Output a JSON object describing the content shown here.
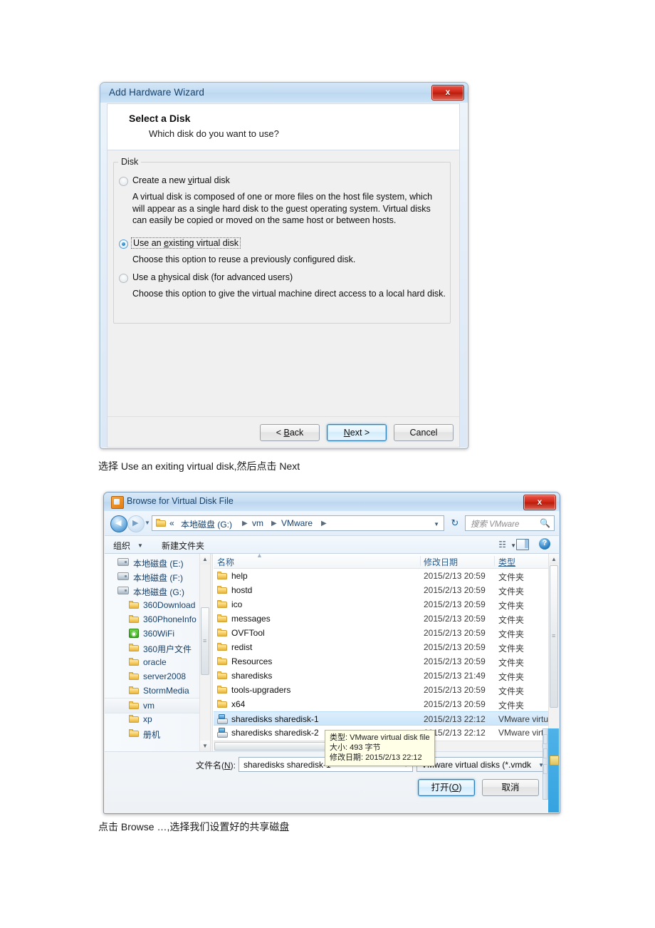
{
  "wizard": {
    "title": "Add Hardware Wizard",
    "close_label": "x",
    "header_title": "Select a Disk",
    "header_subtitle": "Which disk do you want to use?",
    "group_label": "Disk",
    "options": [
      {
        "label_pre": "Create a new ",
        "label_accel": "v",
        "label_post": "irtual disk",
        "selected": false,
        "description": "A virtual disk is composed of one or more files on the host file system, which will appear as a single hard disk to the guest operating system. Virtual disks can easily be copied or moved on the same host or between hosts."
      },
      {
        "label_pre": "Use an ",
        "label_accel": "e",
        "label_post": "xisting virtual disk",
        "selected": true,
        "focused": true,
        "description": "Choose this option to reuse a previously configured disk."
      },
      {
        "label_pre": "Use a ",
        "label_accel": "p",
        "label_post": "hysical disk (for advanced users)",
        "selected": false,
        "description": "Choose this option to give the virtual machine direct access to a local hard disk."
      }
    ],
    "buttons": {
      "back_pre": "< ",
      "back_accel": "B",
      "back_post": "ack",
      "next_pre": "",
      "next_accel": "N",
      "next_post": "ext >",
      "cancel": "Cancel"
    }
  },
  "caption1": "选择 Use an exiting virtual disk,然后点击 Next",
  "caption2": "点击 Browse …,选择我们设置好的共享磁盘",
  "browse": {
    "title": "Browse for Virtual Disk File",
    "close_label": "x",
    "address": {
      "back_glyph": "◀",
      "forward_glyph": "▶",
      "recent_glyph": "▼",
      "chevrons": "«",
      "crumbs": [
        "本地磁盘 (G:)",
        "vm",
        "VMware"
      ],
      "crumb_separator": "▶",
      "dropdown_glyph": "▼",
      "refresh_glyph": "↻"
    },
    "search": {
      "placeholder": "搜索 VMware",
      "icon": "search-icon",
      "icon_glyph": "🔍"
    },
    "commandbar": {
      "organize": "组织",
      "organize_caret": "▼",
      "new_folder": "新建文件夹",
      "view_glyph": "☷",
      "view_caret": "▼",
      "preview_pane": "preview-pane-icon",
      "help_glyph": "?"
    },
    "navpane": {
      "items": [
        {
          "label": "本地磁盘 (E:)",
          "icon": "drive-icon",
          "indent": 18,
          "selected": false
        },
        {
          "label": "本地磁盘 (F:)",
          "icon": "drive-icon",
          "indent": 18,
          "selected": false
        },
        {
          "label": "本地磁盘 (G:)",
          "icon": "drive-icon",
          "indent": 18,
          "selected": false
        },
        {
          "label": "360Download",
          "icon": "folder-icon",
          "indent": 34,
          "selected": false
        },
        {
          "label": "360PhoneInfo",
          "icon": "folder-icon",
          "indent": 34,
          "selected": false
        },
        {
          "label": "360WiFi",
          "icon": "wifi-icon",
          "indent": 34,
          "selected": false
        },
        {
          "label": "360用户文件",
          "icon": "folder-icon",
          "indent": 34,
          "selected": false
        },
        {
          "label": "oracle",
          "icon": "folder-icon",
          "indent": 34,
          "selected": false
        },
        {
          "label": "server2008",
          "icon": "folder-icon",
          "indent": 34,
          "selected": false
        },
        {
          "label": "StormMedia",
          "icon": "folder-icon",
          "indent": 34,
          "selected": false
        },
        {
          "label": "vm",
          "icon": "folder-icon",
          "indent": 34,
          "selected": true
        },
        {
          "label": "xp",
          "icon": "folder-icon",
          "indent": 34,
          "selected": false
        },
        {
          "label": "册机",
          "icon": "folder-icon",
          "indent": 34,
          "selected": false
        }
      ]
    },
    "filelist": {
      "columns": [
        "名称",
        "修改日期",
        "类型"
      ],
      "rows": [
        {
          "name": "help",
          "date": "2015/2/13 20:59",
          "type": "文件夹",
          "icon": "folder-icon",
          "selected": false
        },
        {
          "name": "hostd",
          "date": "2015/2/13 20:59",
          "type": "文件夹",
          "icon": "folder-icon",
          "selected": false
        },
        {
          "name": "ico",
          "date": "2015/2/13 20:59",
          "type": "文件夹",
          "icon": "folder-icon",
          "selected": false
        },
        {
          "name": "messages",
          "date": "2015/2/13 20:59",
          "type": "文件夹",
          "icon": "folder-icon",
          "selected": false
        },
        {
          "name": "OVFTool",
          "date": "2015/2/13 20:59",
          "type": "文件夹",
          "icon": "folder-icon",
          "selected": false
        },
        {
          "name": "redist",
          "date": "2015/2/13 20:59",
          "type": "文件夹",
          "icon": "folder-icon",
          "selected": false
        },
        {
          "name": "Resources",
          "date": "2015/2/13 20:59",
          "type": "文件夹",
          "icon": "folder-icon",
          "selected": false
        },
        {
          "name": "sharedisks",
          "date": "2015/2/13 21:49",
          "type": "文件夹",
          "icon": "folder-icon",
          "selected": false
        },
        {
          "name": "tools-upgraders",
          "date": "2015/2/13 20:59",
          "type": "文件夹",
          "icon": "folder-icon",
          "selected": false
        },
        {
          "name": "x64",
          "date": "2015/2/13 20:59",
          "type": "文件夹",
          "icon": "folder-icon",
          "selected": false
        },
        {
          "name": "sharedisks sharedisk-1",
          "date": "2015/2/13 22:12",
          "type": "VMware virtual",
          "icon": "vmdk-icon",
          "selected": true
        },
        {
          "name": "sharedisks sharedisk-2",
          "date": "2015/2/13 22:12",
          "type": "VMware virtual",
          "icon": "vmdk-icon",
          "selected": false
        }
      ]
    },
    "tooltip": {
      "type_label": "类型",
      "type_value": "VMware virtual disk file",
      "size_label": "大小",
      "size_value": "493 字节",
      "date_label": "修改日期",
      "date_value": "2015/2/13 22:12"
    },
    "bottom": {
      "filename_label_pre": "文件名(",
      "filename_label_accel": "N",
      "filename_label_post": "):",
      "filename_value": "sharedisks sharedisk-1",
      "filetype_value": "VMware virtual disks (*.vmdk",
      "dropdown_glyph": "▼",
      "open_pre": "打开(",
      "open_accel": "O",
      "open_post": ")",
      "cancel": "取消"
    }
  },
  "colors": {
    "accent": "#2c7fb9",
    "selection": "#cbe5fa",
    "title_text": "#16416b",
    "tooltip_bg": "#ffffe8",
    "close_red": "#cf2414",
    "desktop_blue": "#35a3e0"
  }
}
